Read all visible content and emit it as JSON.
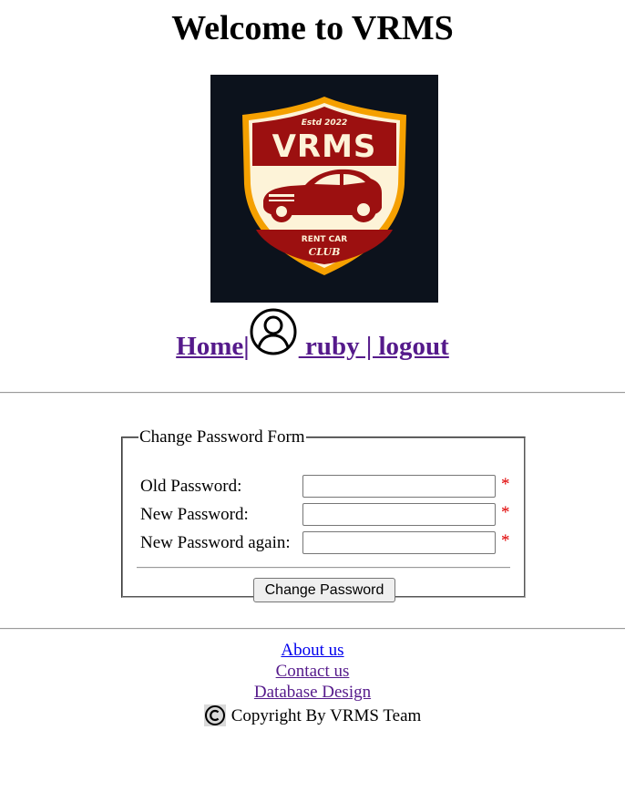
{
  "header": {
    "title": "Welcome to VRMS"
  },
  "logo": {
    "estd": "Estd 2022",
    "brand": "VRMS",
    "tagline": "RENT CAR",
    "club": "CLUB",
    "colors": {
      "background": "#0c121c",
      "shield_border": "#f5a000",
      "shield_red": "#9c1010",
      "cream": "#fdf3d8"
    }
  },
  "nav": {
    "home": "Home",
    "separator": "|",
    "user_icon": "user-circle-icon",
    "user_text": " ruby | logout"
  },
  "form": {
    "legend": "Change Password Form",
    "fields": [
      {
        "label": "Old Password:",
        "value": "",
        "required_mark": "*"
      },
      {
        "label": "New Password:",
        "value": "",
        "required_mark": "*"
      },
      {
        "label": "New Password again:",
        "value": "",
        "required_mark": "*"
      }
    ],
    "submit_label": "Change Password"
  },
  "footer": {
    "links": [
      "About us",
      "Contact us",
      "Database Design"
    ],
    "copyright_icon": "copyright-icon",
    "copyright_text": "Copyright By VRMS Team"
  }
}
